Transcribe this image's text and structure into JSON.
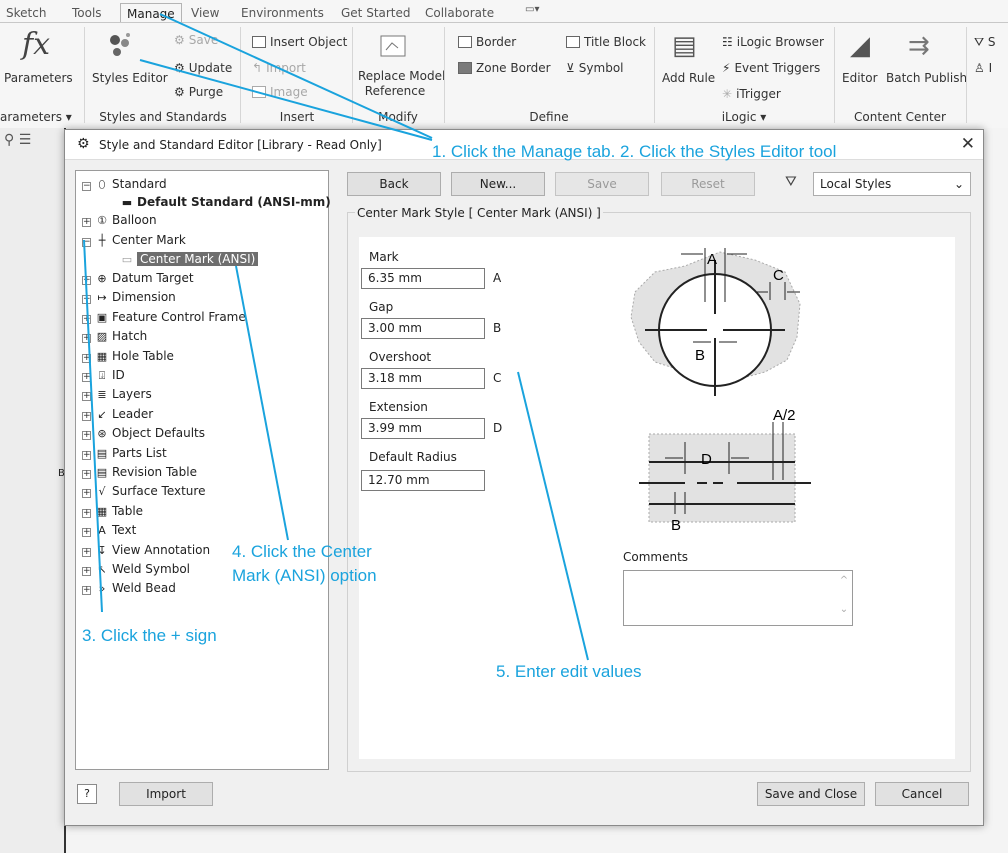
{
  "ribbon": {
    "tabs": [
      "Sketch",
      "Tools",
      "Manage",
      "View",
      "Environments",
      "Get Started",
      "Collaborate"
    ],
    "parameters_label": "Parameters",
    "styles_editor_label": "Styles Editor",
    "save_label": "Save",
    "update_label": "Update",
    "purge_label": "Purge",
    "insert_object_label": "Insert Object",
    "import_label": "Import",
    "image_label": "Image",
    "replace_model_line1": "Replace Model",
    "replace_model_line2": "Reference",
    "border_label": "Border",
    "title_block_label": "Title Block",
    "zone_border_label": "Zone Border",
    "symbol_label": "Symbol",
    "add_rule_label": "Add Rule",
    "ilogic_browser_label": "iLogic Browser",
    "event_triggers_label": "Event Triggers",
    "itrigger_label": "iTrigger",
    "editor_label": "Editor",
    "batch_publish_label": "Batch Publish",
    "panels": [
      "arameters ▾",
      "Styles and Standards",
      "Insert",
      "Modify",
      "Define",
      "iLogic ▾",
      "Content Center"
    ]
  },
  "dialog": {
    "title": "Style and Standard Editor [Library - Read Only]",
    "buttons": {
      "back": "Back",
      "new": "New...",
      "save": "Save",
      "reset": "Reset"
    },
    "filter_value": "Local Styles",
    "group_title": "Center Mark Style [ Center Mark (ANSI) ]",
    "tree": {
      "standard": "Standard",
      "default_standard": "Default Standard (ANSI-mm)",
      "balloon": "Balloon",
      "center_mark": "Center Mark",
      "center_mark_ansi": "Center Mark (ANSI)",
      "items": [
        "Datum Target",
        "Dimension",
        "Feature Control Frame",
        "Hatch",
        "Hole Table",
        "ID",
        "Layers",
        "Leader",
        "Object Defaults",
        "Parts List",
        "Revision Table",
        "Surface Texture",
        "Table",
        "Text",
        "View Annotation",
        "Weld Symbol",
        "Weld Bead"
      ]
    },
    "fields": [
      {
        "label": "Mark",
        "value": "6.35 mm",
        "letter": "A"
      },
      {
        "label": "Gap",
        "value": "3.00 mm",
        "letter": "B"
      },
      {
        "label": "Overshoot",
        "value": "3.18 mm",
        "letter": "C"
      },
      {
        "label": "Extension",
        "value": "3.99 mm",
        "letter": "D"
      },
      {
        "label": "Default Radius",
        "value": "12.70 mm",
        "letter": ""
      }
    ],
    "comments_label": "Comments",
    "import_label": "Import",
    "save_close_label": "Save and Close",
    "cancel_label": "Cancel",
    "diagram_labels": {
      "a": "A",
      "b": "B",
      "c": "C",
      "a2": "A/2",
      "d": "D"
    }
  },
  "annotations": {
    "step1": "1. Click the Manage tab. 2. Click the Styles Editor tool",
    "step3": "3. Click the + sign",
    "step4a": "4. Click the Center",
    "step4b": "Mark (ANSI) option",
    "step5": "5. Enter edit values"
  },
  "colors": {
    "annotation": "#1aa3dd",
    "selected": "#6e6e6e"
  }
}
